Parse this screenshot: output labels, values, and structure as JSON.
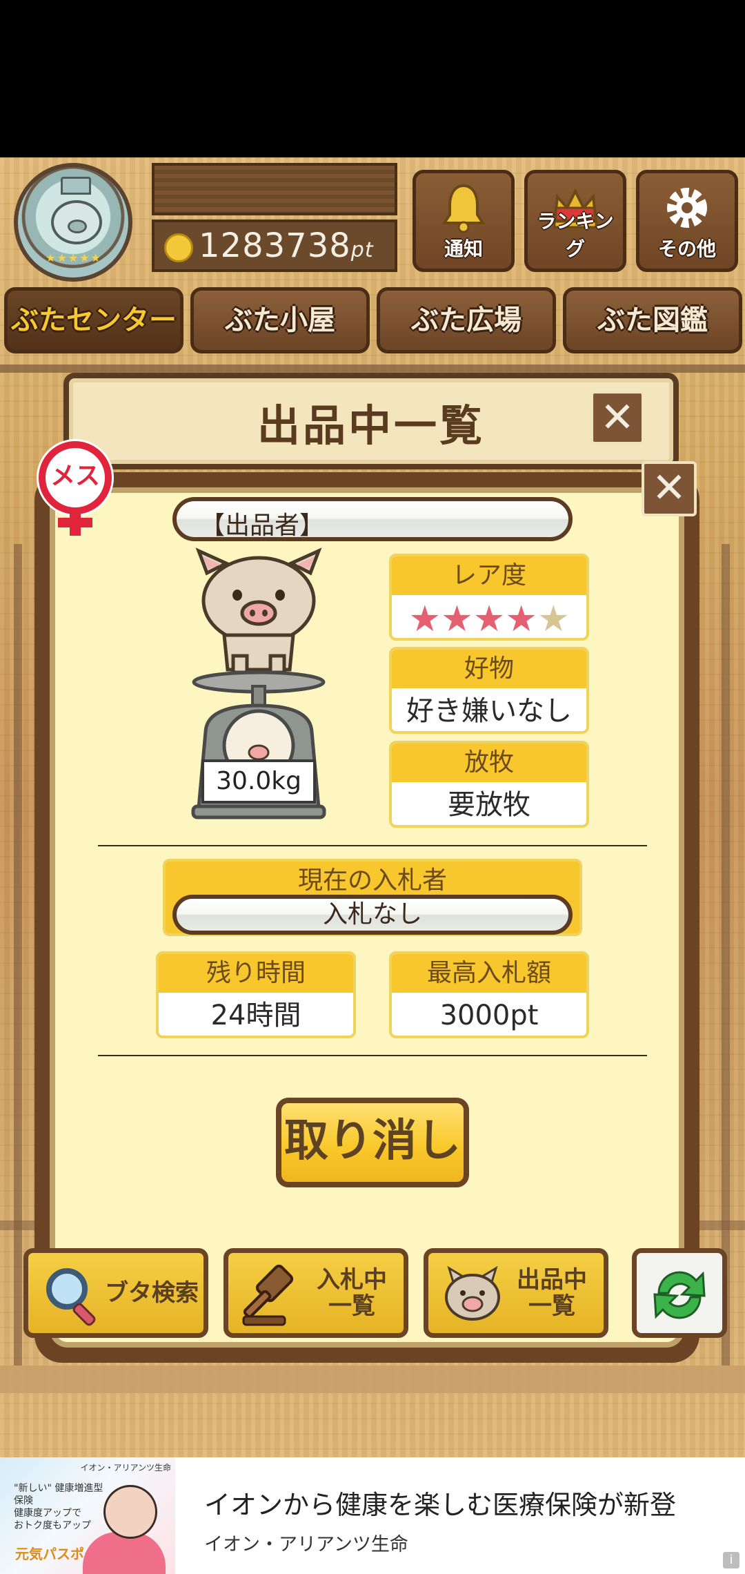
{
  "header": {
    "points_value": "1283738",
    "points_unit": "pt",
    "buttons": [
      {
        "label": "通知",
        "icon": "bell-icon"
      },
      {
        "label": "ランキング",
        "icon": "crown-icon"
      },
      {
        "label": "その他",
        "icon": "gear-icon"
      }
    ]
  },
  "nav": {
    "tabs": [
      {
        "label": "ぶたセンター",
        "active": true
      },
      {
        "label": "ぶた小屋",
        "active": false
      },
      {
        "label": "ぶた広場",
        "active": false
      },
      {
        "label": "ぶた図鑑",
        "active": false
      }
    ]
  },
  "panel": {
    "title": "出品中一覧"
  },
  "listing": {
    "gender_badge": "メス",
    "seller_label": "【出品者】",
    "weight": "30.0kg",
    "rarity": {
      "label": "レア度",
      "stars_filled": 4,
      "stars_total": 5
    },
    "favorite": {
      "label": "好物",
      "value": "好き嫌いなし"
    },
    "grazing": {
      "label": "放牧",
      "value": "要放牧"
    },
    "current_bidder": {
      "label": "現在の入札者",
      "value": "入札なし"
    },
    "time_left": {
      "label": "残り時間",
      "value": "24時間"
    },
    "highest_bid": {
      "label": "最高入札額",
      "value": "3000pt"
    },
    "cancel_label": "取り消し"
  },
  "bottom": {
    "search_label": "ブタ検索",
    "bidding_label": "入札中\n一覧",
    "listing_label": "出品中\n一覧"
  },
  "ad": {
    "title": "イオンから健康を楽しむ医療保険が新登",
    "sponsor": "イオン・アリアンツ生命",
    "img_brand": "イオン・アリアンツ生命",
    "img_copy": "\"新しい\" 健康増進型保険\n健康度アップで\nおトク度もアップ",
    "img_logo": "元気パスポート"
  },
  "colors": {
    "accent_yellow": "#f8c62d",
    "wood_dark": "#6a4424",
    "panel_cream": "#fdf6c0",
    "female_red": "#e0243c"
  }
}
